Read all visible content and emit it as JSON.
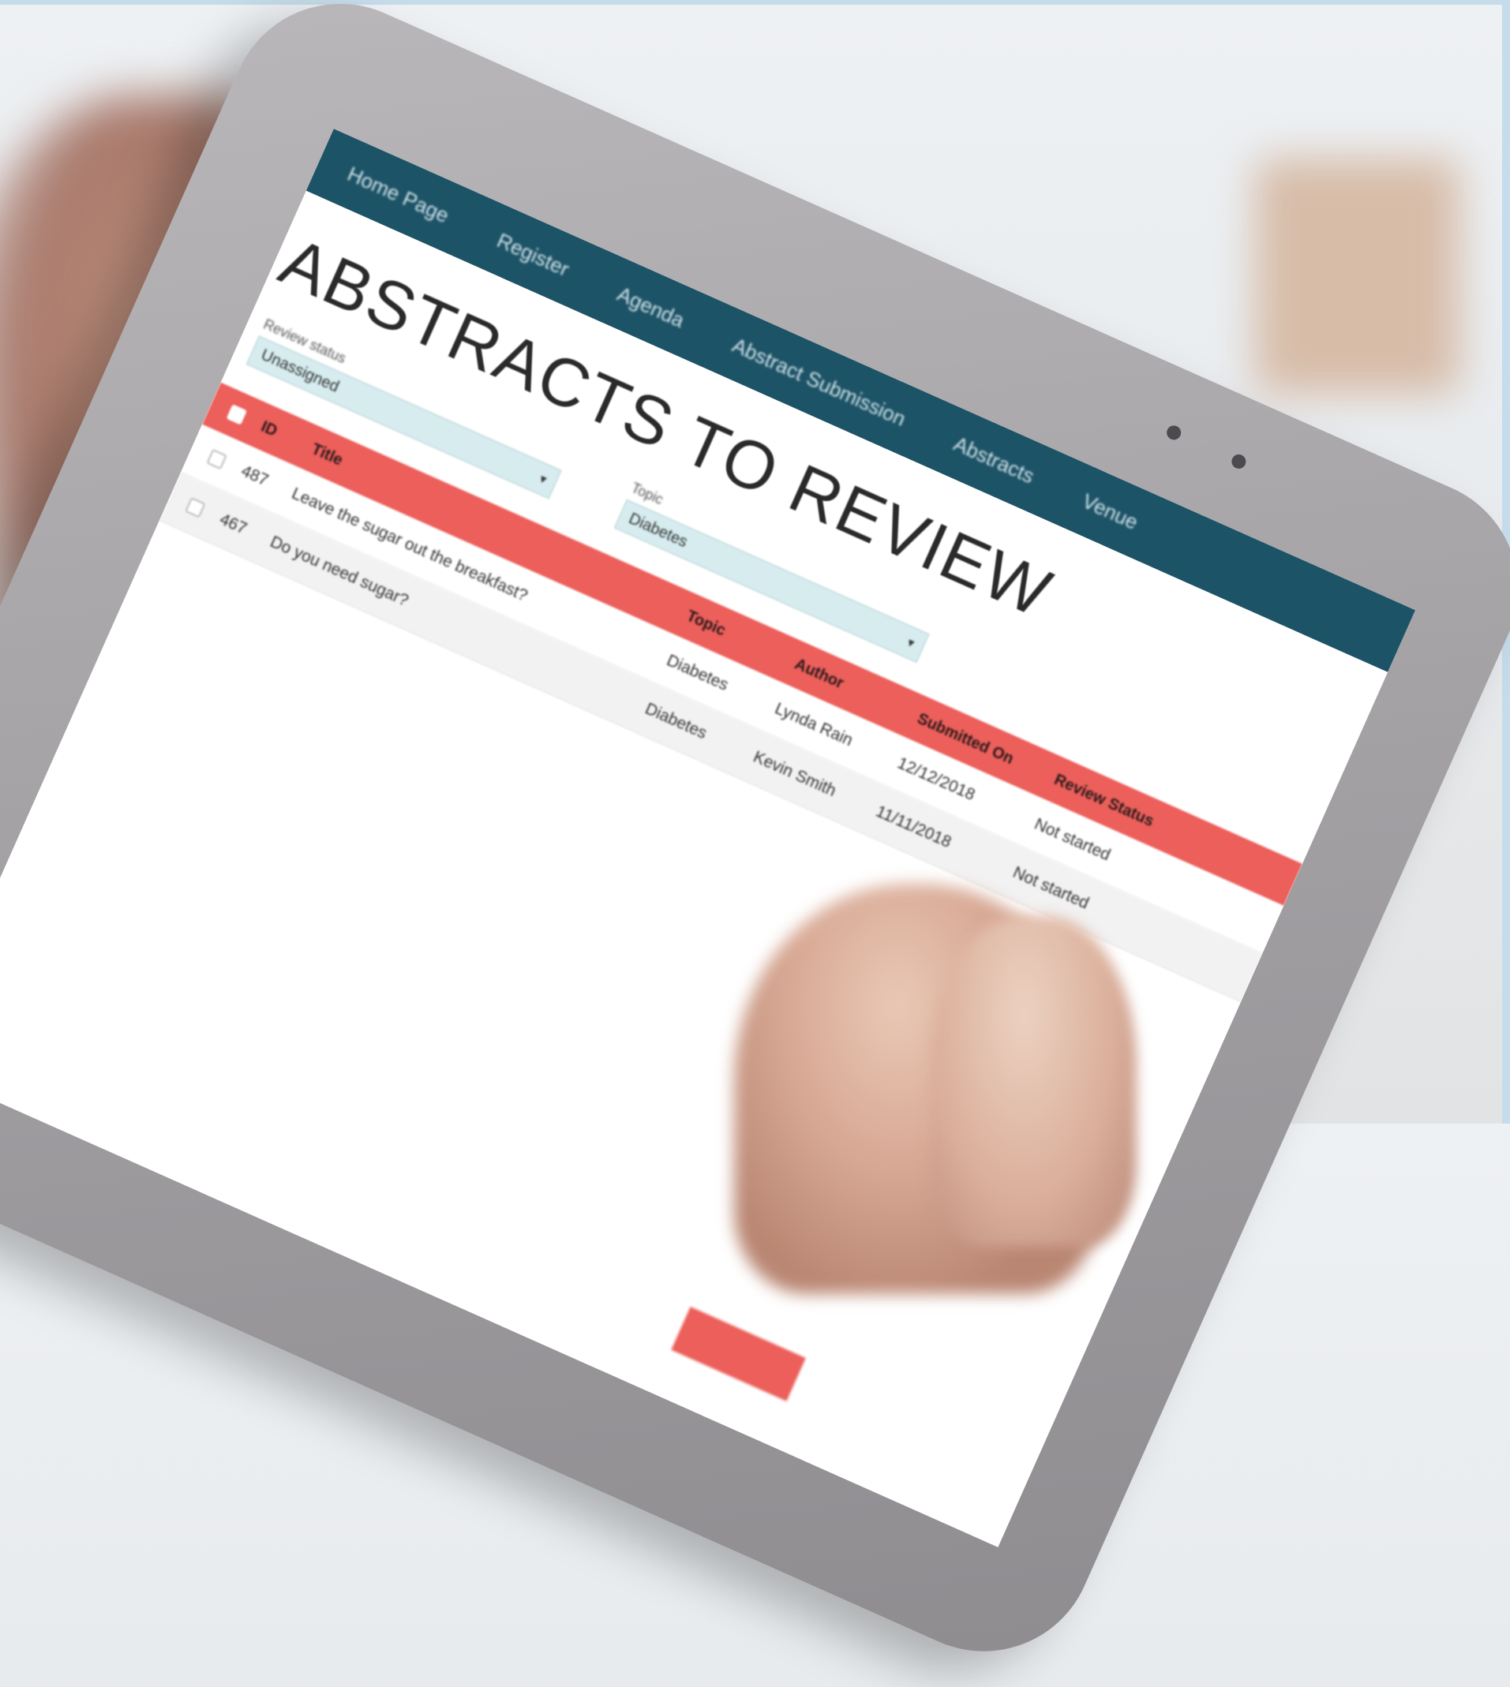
{
  "nav": {
    "items": [
      "Home Page",
      "Register",
      "Agenda",
      "Abstract Submission",
      "Abstracts",
      "Venue"
    ]
  },
  "page": {
    "title": "ABSTRACTS TO REVIEW"
  },
  "filters": {
    "review_status": {
      "label": "Review status",
      "value": "Unassigned"
    },
    "topic": {
      "label": "Topic",
      "value": "Diabetes"
    }
  },
  "table": {
    "headers": [
      "ID",
      "Title",
      "Topic",
      "Author",
      "Submitted On",
      "Review Status"
    ],
    "rows": [
      {
        "id": "487",
        "title": "Leave the sugar out the breakfast?",
        "topic": "Diabetes",
        "author": "Lynda Rain",
        "submitted": "12/12/2018",
        "status": "Not started"
      },
      {
        "id": "467",
        "title": "Do you need sugar?",
        "topic": "Diabetes",
        "author": "Kevin Smith",
        "submitted": "11/11/2018",
        "status": "Not started"
      }
    ]
  },
  "colors": {
    "navbar": "#1d5366",
    "table_header": "#ec5f5b",
    "select_bg": "#d6ecef"
  }
}
